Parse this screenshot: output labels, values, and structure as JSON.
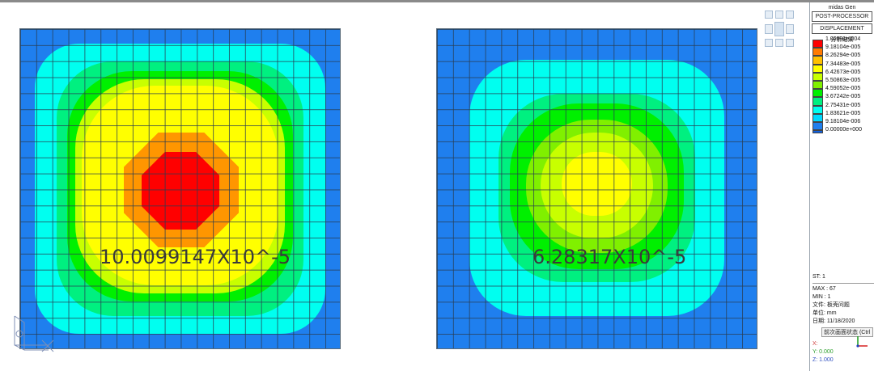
{
  "colors": {
    "c0": "#1f7fee",
    "c1": "#00d0ff",
    "c2": "#00fff0",
    "c3": "#00f080",
    "c4": "#00f000",
    "c5": "#80f000",
    "c6": "#c8ff00",
    "c7": "#ffff00",
    "c8": "#ffd200",
    "c9": "#ff9600",
    "c10": "#ff0000"
  },
  "plates": [
    {
      "value_label": "10.0099147X10^-5"
    },
    {
      "value_label": "6.28317X10^-5"
    }
  ],
  "panel": {
    "app_name": "midas Gen",
    "module": "POST-PROCESSOR",
    "result_type": "DISPLACEMENT",
    "result_subtitle": "分析结果",
    "legend": [
      {
        "label": "1.00991e-004",
        "color": "#ff0000"
      },
      {
        "label": "9.18104e-005",
        "color": "#ff7a00"
      },
      {
        "label": "8.26294e-005",
        "color": "#ffc000"
      },
      {
        "label": "7.34483e-005",
        "color": "#ffff00"
      },
      {
        "label": "6.42673e-005",
        "color": "#c8ff00"
      },
      {
        "label": "5.50863e-005",
        "color": "#80f000"
      },
      {
        "label": "4.59052e-005",
        "color": "#00f000"
      },
      {
        "label": "3.67242e-005",
        "color": "#00f080"
      },
      {
        "label": "2.75431e-005",
        "color": "#00fff0"
      },
      {
        "label": "1.83621e-005",
        "color": "#00d8ff"
      },
      {
        "label": "9.18104e-006",
        "color": "#1f7fee"
      },
      {
        "label": "0.00000e+000",
        "color": "#1060e0"
      }
    ],
    "st": "ST: 1",
    "max": "MAX : 67",
    "min": "MIN : 1",
    "file": "文件: 板壳问题",
    "unit": "单位: mm",
    "date": "日期: 11/18/2020",
    "tooltip": "前次画面状态 (Ctrl",
    "x_coord": "X: ",
    "y_coord": "Y: 0.000",
    "z_coord": "Z: 1.000"
  }
}
